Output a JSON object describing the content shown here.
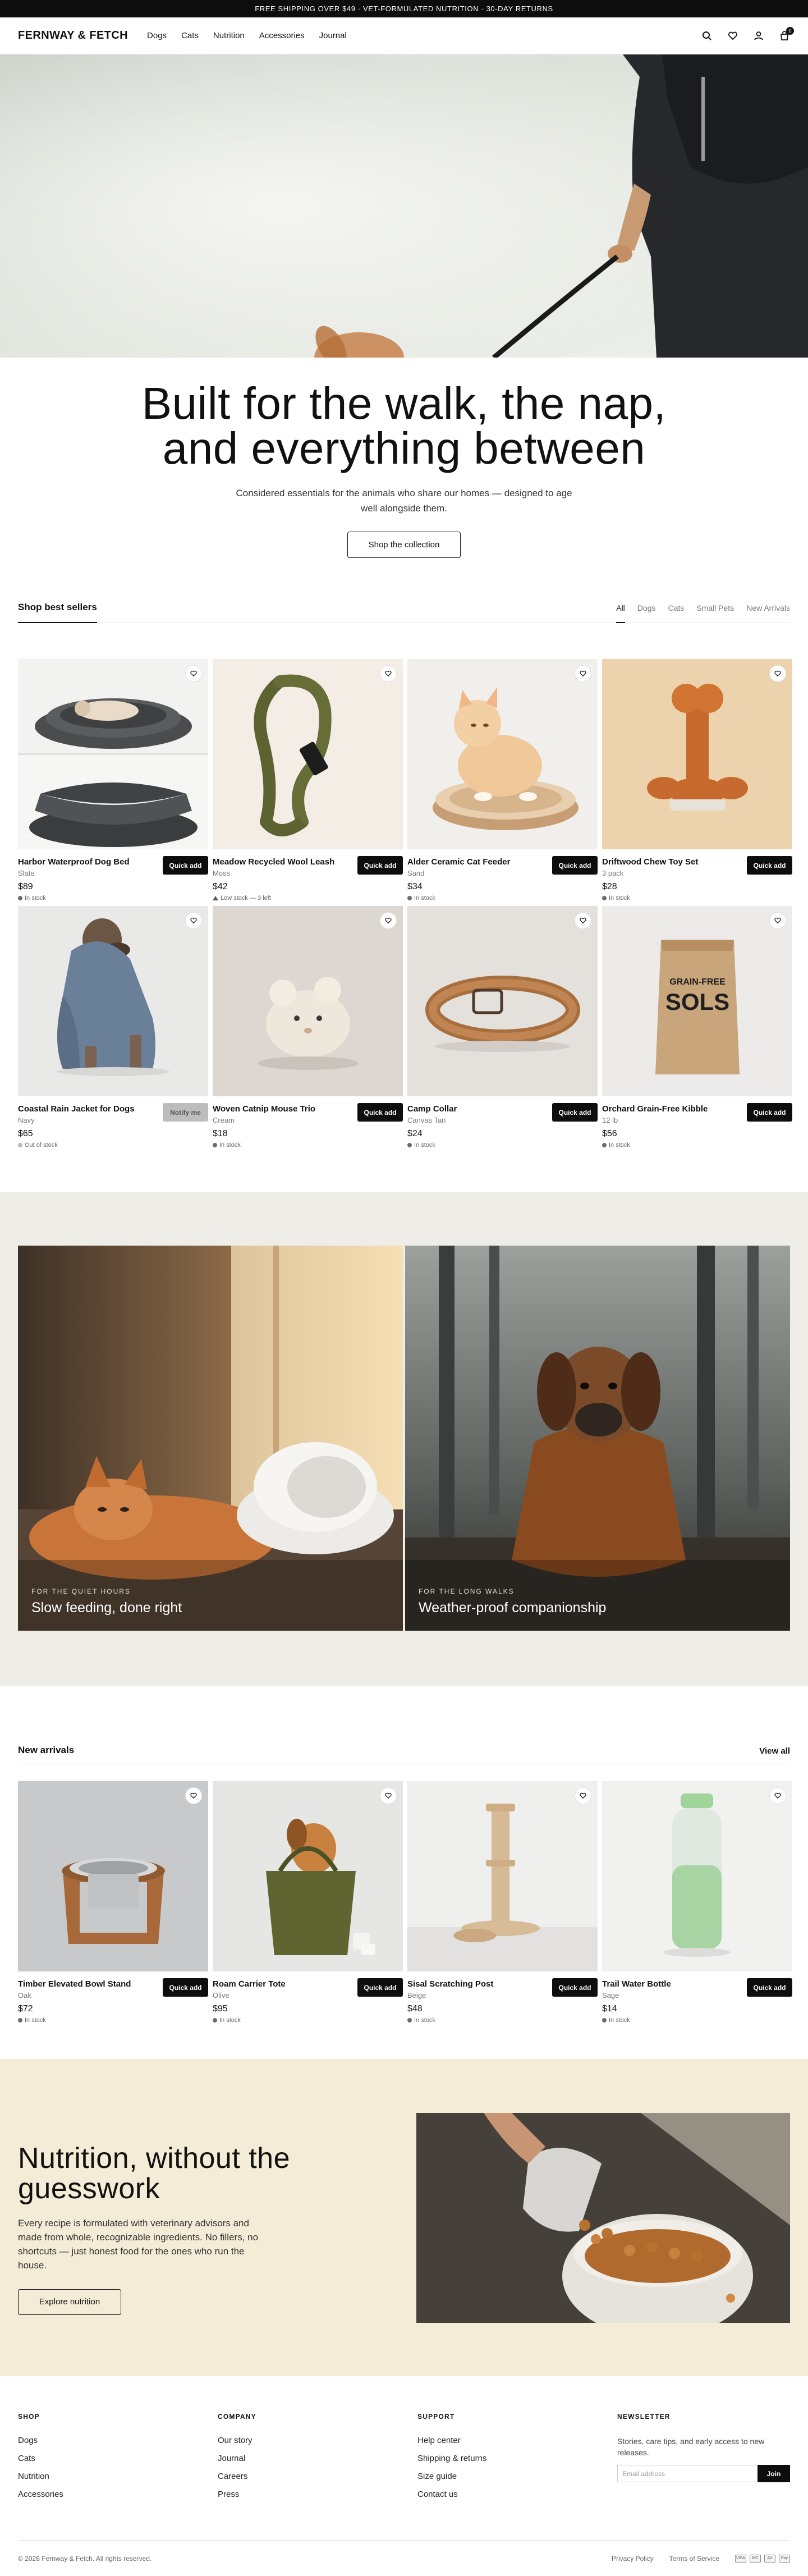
{
  "announcement": "FREE SHIPPING OVER $49 · VET-FORMULATED NUTRITION · 30-DAY RETURNS",
  "header": {
    "logo": "FERNWAY & FETCH",
    "nav": [
      "Dogs",
      "Cats",
      "Nutrition",
      "Accessories",
      "Journal"
    ],
    "icons": [
      "search-icon",
      "heart-icon",
      "user-icon",
      "bag-icon"
    ],
    "cart_count": "0"
  },
  "hero": {
    "title": "Built for the walk, the nap, and everything between",
    "subtitle": "Considered essentials for the animals who share our homes — designed to age well alongside them.",
    "cta": "Shop the collection"
  },
  "best_sellers": {
    "title": "Shop best sellers",
    "filters": [
      "All",
      "Dogs",
      "Cats",
      "Small Pets",
      "New Arrivals"
    ],
    "active_filter": "All",
    "products": [
      {
        "name": "Harbor Waterproof Dog Bed",
        "variant": "Slate",
        "price": "$89",
        "stock": "In stock",
        "stock_color": "#6b6b6b",
        "button": "Quick add"
      },
      {
        "name": "Meadow Recycled Wool Leash",
        "variant": "Moss",
        "price": "$42",
        "stock": "Low stock — 3 left",
        "stock_color": "#555555",
        "button": "Quick add"
      },
      {
        "name": "Alder Ceramic Cat Feeder",
        "variant": "Sand",
        "price": "$34",
        "stock": "In stock",
        "stock_color": "#6b6b6b",
        "button": "Quick add"
      },
      {
        "name": "Driftwood Chew Toy Set",
        "variant": "3 pack",
        "price": "$28",
        "stock": "In stock",
        "stock_color": "#6b6b6b",
        "button": "Quick add"
      },
      {
        "name": "Coastal Rain Jacket for Dogs",
        "variant": "Navy",
        "price": "$65",
        "stock": "Out of stock",
        "stock_color": "#bbbbbb",
        "button": "Notify me"
      },
      {
        "name": "Woven Catnip Mouse Trio",
        "variant": "Cream",
        "price": "$18",
        "stock": "In stock",
        "stock_color": "#6b6b6b",
        "button": "Quick add"
      },
      {
        "name": "Camp Collar",
        "variant": "Canvas Tan",
        "price": "$24",
        "stock": "In stock",
        "stock_color": "#6b6b6b",
        "button": "Quick add"
      },
      {
        "name": "Orchard Grain-Free Kibble",
        "variant": "12 lb",
        "price": "$56",
        "stock": "In stock",
        "stock_color": "#6b6b6b",
        "button": "Quick add"
      }
    ]
  },
  "kibble_bag_text": {
    "line1": "GRAIN-FREE",
    "line2": "SOLS"
  },
  "editorial": [
    {
      "kicker": "FOR THE QUIET HOURS",
      "headline": "Slow feeding, done right"
    },
    {
      "kicker": "FOR THE LONG WALKS",
      "headline": "Weather-proof companionship"
    }
  ],
  "new_arrivals": {
    "title": "New arrivals",
    "link": "View all",
    "products": [
      {
        "name": "Timber Elevated Bowl Stand",
        "variant": "Oak",
        "price": "$72",
        "stock": "In stock",
        "button": "Quick add"
      },
      {
        "name": "Roam Carrier Tote",
        "variant": "Olive",
        "price": "$95",
        "stock": "In stock",
        "button": "Quick add"
      },
      {
        "name": "Sisal Scratching Post",
        "variant": "Beige",
        "price": "$48",
        "stock": "In stock",
        "button": "Quick add"
      },
      {
        "name": "Trail Water Bottle",
        "variant": "Sage",
        "price": "$14",
        "stock": "In stock",
        "button": "Quick add"
      }
    ]
  },
  "nutrition": {
    "title": "Nutrition, without the guesswork",
    "body": "Every recipe is formulated with veterinary advisors and made from whole, recognizable ingredients. No fillers, no shortcuts — just honest food for the ones who run the house.",
    "cta": "Explore nutrition"
  },
  "footer": {
    "columns": [
      {
        "heading": "SHOP",
        "links": [
          "Dogs",
          "Cats",
          "Nutrition",
          "Accessories"
        ]
      },
      {
        "heading": "COMPANY",
        "links": [
          "Our story",
          "Journal",
          "Careers",
          "Press"
        ]
      },
      {
        "heading": "SUPPORT",
        "links": [
          "Help center",
          "Shipping & returns",
          "Size guide",
          "Contact us"
        ]
      }
    ],
    "newsletter": {
      "heading": "NEWSLETTER",
      "text": "Stories, care tips, and early access to new releases.",
      "placeholder": "Email address",
      "button": "Join"
    },
    "copyright": "© 2026 Fernway & Fetch. All rights reserved.",
    "legal": [
      "Privacy Policy",
      "Terms of Service"
    ],
    "payment_icons": [
      "visa-icon",
      "mastercard-icon",
      "amex-icon",
      "applepay-icon"
    ],
    "payment_labels": [
      "VISA",
      "MC",
      "AX",
      "Pay"
    ]
  },
  "colors": {
    "accent": "#0d0d0d",
    "editorial_bg": "#eeede8",
    "nutrition_bg": "#f4ecd7"
  }
}
